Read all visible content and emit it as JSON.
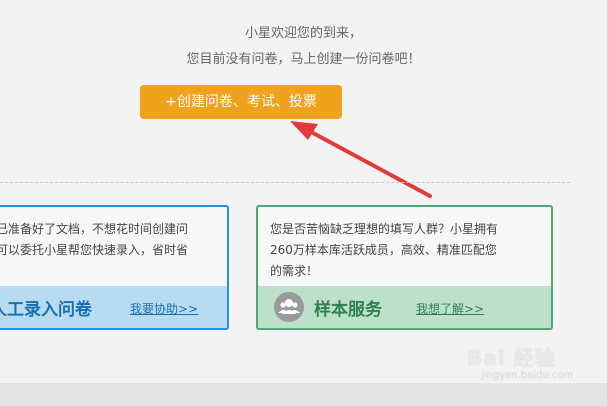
{
  "welcome": {
    "line1": "小星欢迎您的到来，",
    "line2": "您目前没有问卷，马上创建一份问卷吧！"
  },
  "create_button": {
    "label": "+创建问卷、考试、投票"
  },
  "cards": {
    "manual_entry": {
      "line1": "已准备好了文档，不想花时间创建问",
      "line2": "可以委托小星帮您快速录入，省时省",
      "title": "人工录入问卷",
      "link": "我要协助>>"
    },
    "sample_service": {
      "line1": "您是否苦恼缺乏理想的填写人群？小星拥有",
      "line2": "260万样本库活跃成员，高效、精准匹配您",
      "line3": "的需求！",
      "title": "样本服务",
      "link": "我想了解>>"
    }
  },
  "watermark": {
    "brand": "Bai 经验",
    "url": "jingyan.baidu.com"
  },
  "colors": {
    "orange": "#f0a21e",
    "blue": "#2b91d6",
    "green": "#4fa775",
    "arrow_red": "#e23a3a"
  }
}
